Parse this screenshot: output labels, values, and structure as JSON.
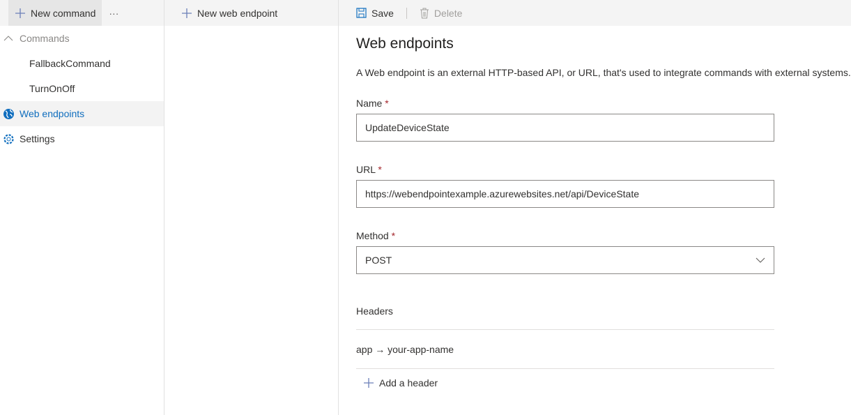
{
  "left": {
    "new_command": "New command",
    "more": "···",
    "nav": {
      "commands": "Commands",
      "fallback": "FallbackCommand",
      "turnonoff": "TurnOnOff",
      "web_endpoints": "Web endpoints",
      "settings": "Settings"
    }
  },
  "middle": {
    "new_web_endpoint": "New web endpoint"
  },
  "toolbar": {
    "save": "Save",
    "delete": "Delete"
  },
  "main": {
    "title": "Web endpoints",
    "description": "A Web endpoint is an external HTTP-based API, or URL, that's used to integrate commands with external systems.",
    "name_label": "Name",
    "name_value": "UpdateDeviceState",
    "url_label": "URL",
    "url_value": "https://webendpointexample.azurewebsites.net/api/DeviceState",
    "method_label": "Method",
    "method_value": "POST",
    "required_mark": "*",
    "headers_label": "Headers",
    "header_entry": "app → your-app-name",
    "add_header": "Add a header"
  },
  "colors": {
    "accent": "#106ebe",
    "required": "#a4262c",
    "toolbar_bg": "#f4f4f4"
  }
}
